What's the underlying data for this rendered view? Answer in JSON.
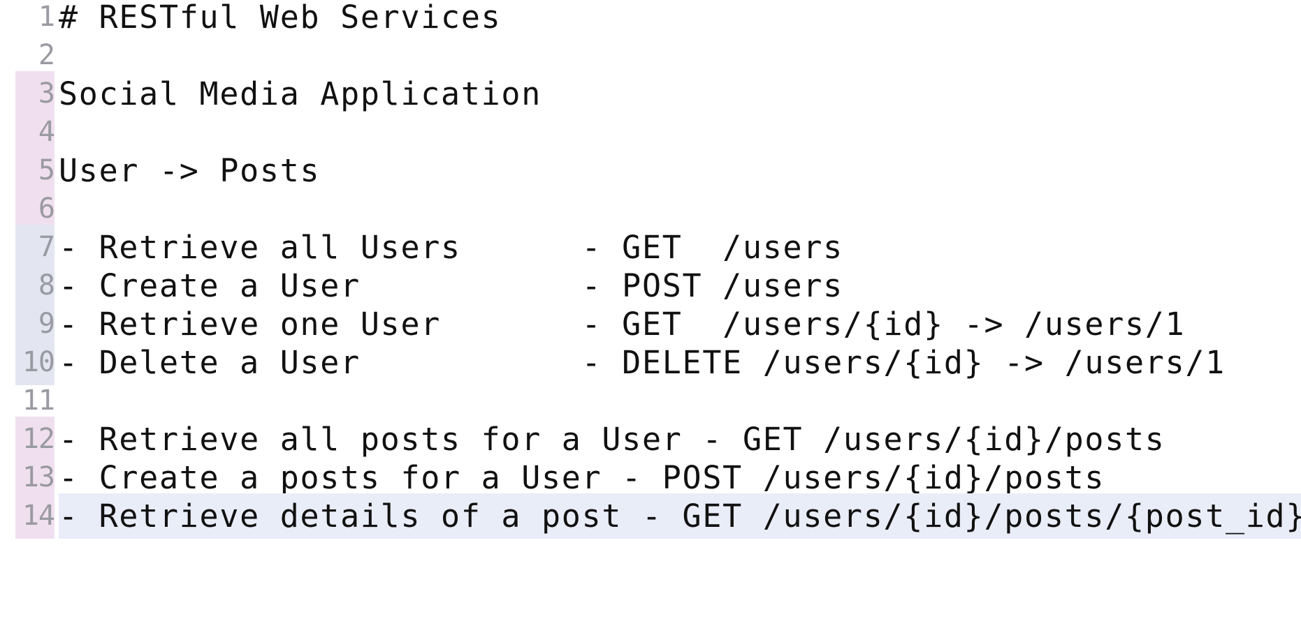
{
  "editor": {
    "lines": [
      {
        "num": "1",
        "text": "# RESTful Web Services"
      },
      {
        "num": "2",
        "text": ""
      },
      {
        "num": "3",
        "text": "Social Media Application"
      },
      {
        "num": "4",
        "text": ""
      },
      {
        "num": "5",
        "text": "User -> Posts"
      },
      {
        "num": "6",
        "text": ""
      },
      {
        "num": "7",
        "text": "- Retrieve all Users      - GET  /users"
      },
      {
        "num": "8",
        "text": "- Create a User           - POST /users"
      },
      {
        "num": "9",
        "text": "- Retrieve one User       - GET  /users/{id} -> /users/1"
      },
      {
        "num": "10",
        "text": "- Delete a User           - DELETE /users/{id} -> /users/1"
      },
      {
        "num": "11",
        "text": ""
      },
      {
        "num": "12",
        "text": "- Retrieve all posts for a User - GET /users/{id}/posts"
      },
      {
        "num": "13",
        "text": "- Create a posts for a User - POST /users/{id}/posts"
      },
      {
        "num": "14",
        "text": "- Retrieve details of a post - GET /users/{id}/posts/{post_id}"
      }
    ]
  },
  "colors": {
    "gutter_mark_pink": "#f0e0ef",
    "gutter_mark_blue": "#e3e6f1",
    "current_line_highlight": "#e9edf8",
    "line_number": "#9a9aa2",
    "text": "#111111"
  }
}
